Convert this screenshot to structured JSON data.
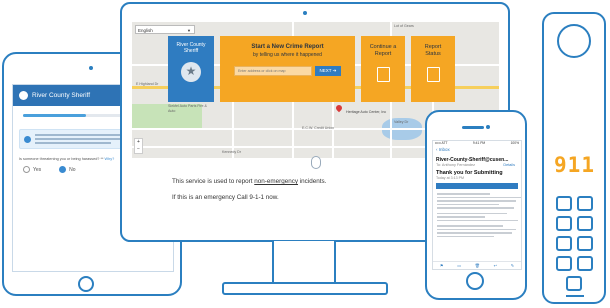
{
  "colors": {
    "outline": "#2b7fc0",
    "brand_blue": "#2f7cc1",
    "accent_orange": "#f5a623"
  },
  "tablet": {
    "app_title": "River County Sheriff",
    "progress": 0.45,
    "info_lines": 3,
    "question": "Is someone threatening you or being harassed? **",
    "question_link": "Why?",
    "options": [
      "Yes",
      "No"
    ],
    "selected_option": "No"
  },
  "monitor": {
    "language": "English",
    "sheriff_card": {
      "title": "River County Sheriff"
    },
    "report_card": {
      "title": "Start a New Crime Report",
      "subtitle": "by telling us where it happened",
      "input_placeholder": "Enter address or click on map",
      "next_label": "NEXT ➔"
    },
    "continue_card": {
      "title": "Continue a Report"
    },
    "status_card": {
      "title": "Report Status"
    },
    "map": {
      "labels": {
        "lot": "Lot of Gears",
        "payne": "Payne St",
        "poppin": "Poppin Road",
        "highland_n": "E Highland Dr",
        "highland_s": "S Highland Dr",
        "park": "Siekfel Auto Parts Fire & Auto",
        "business": "Heritage Auto Center, Inc",
        "side_st": "Valley Dr",
        "credit": "E.C.W. Credit Union",
        "bottom": "Kennedy Dr"
      }
    },
    "notice_line1_prefix": "This service is used to report ",
    "notice_link": "non-emergency",
    "notice_line1_suffix": " incidents.",
    "notice_line2": "If this is an emergency Call 9-1-1 now."
  },
  "phone": {
    "status_carrier": "••••• ATT",
    "status_time": "9:41 PM",
    "status_battery": "100%",
    "back_label": "‹ Inbox",
    "from": "River-County-Sheriff@cusen...",
    "to": "To: Anthony Fernández",
    "details_label": "Details",
    "subject": "Thank you for Submitting",
    "date": "Today at 3:13 PM",
    "body_lines": 12
  },
  "remote": {
    "display": "911",
    "keys": 9
  }
}
